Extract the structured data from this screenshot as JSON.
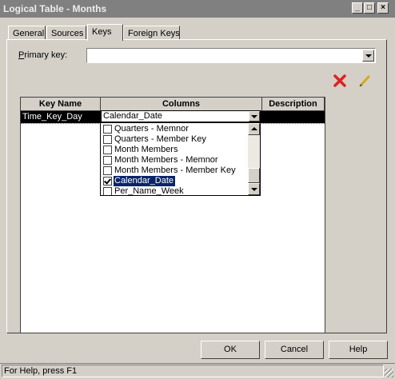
{
  "window": {
    "title": "Logical Table - Months"
  },
  "title_buttons": {
    "minimize": "_",
    "maximize": "□",
    "close": "×"
  },
  "tabs": [
    {
      "label": "General",
      "active": false
    },
    {
      "label": "Sources",
      "active": false
    },
    {
      "label": "Keys",
      "active": true
    },
    {
      "label": "Foreign Keys",
      "active": false
    }
  ],
  "primary_key": {
    "label_prefix": "P",
    "label_rest": "rimary key:",
    "value": ""
  },
  "toolbar": {
    "delete_icon": "red-x-delete-icon",
    "edit_icon": "pencil-edit-icon"
  },
  "grid": {
    "headers": [
      "Key Name",
      "Columns",
      "Description"
    ],
    "rows": [
      {
        "key_name": "Time_Key_Day",
        "columns": "Calendar_Date",
        "description": ""
      }
    ]
  },
  "columns_dropdown": {
    "value": "Calendar_Date",
    "items": [
      {
        "label": "Quarters -  Memnor",
        "checked": false,
        "selected": false
      },
      {
        "label": "Quarters - Member Key",
        "checked": false,
        "selected": false
      },
      {
        "label": "Month Members",
        "checked": false,
        "selected": false
      },
      {
        "label": "Month Members -  Memnor",
        "checked": false,
        "selected": false
      },
      {
        "label": "Month Members - Member Key",
        "checked": false,
        "selected": false
      },
      {
        "label": "Calendar_Date",
        "checked": true,
        "selected": true
      },
      {
        "label": "Per_Name_Week",
        "checked": false,
        "selected": false
      }
    ]
  },
  "buttons": {
    "ok": "OK",
    "cancel": "Cancel",
    "help": "Help"
  },
  "status": {
    "text": "For Help, press F1"
  },
  "colors": {
    "face": "#d4d0c8",
    "title_inactive": "#808080",
    "highlight": "#0a246a",
    "delete_red": "#e02020",
    "pencil": "#d9a520"
  }
}
